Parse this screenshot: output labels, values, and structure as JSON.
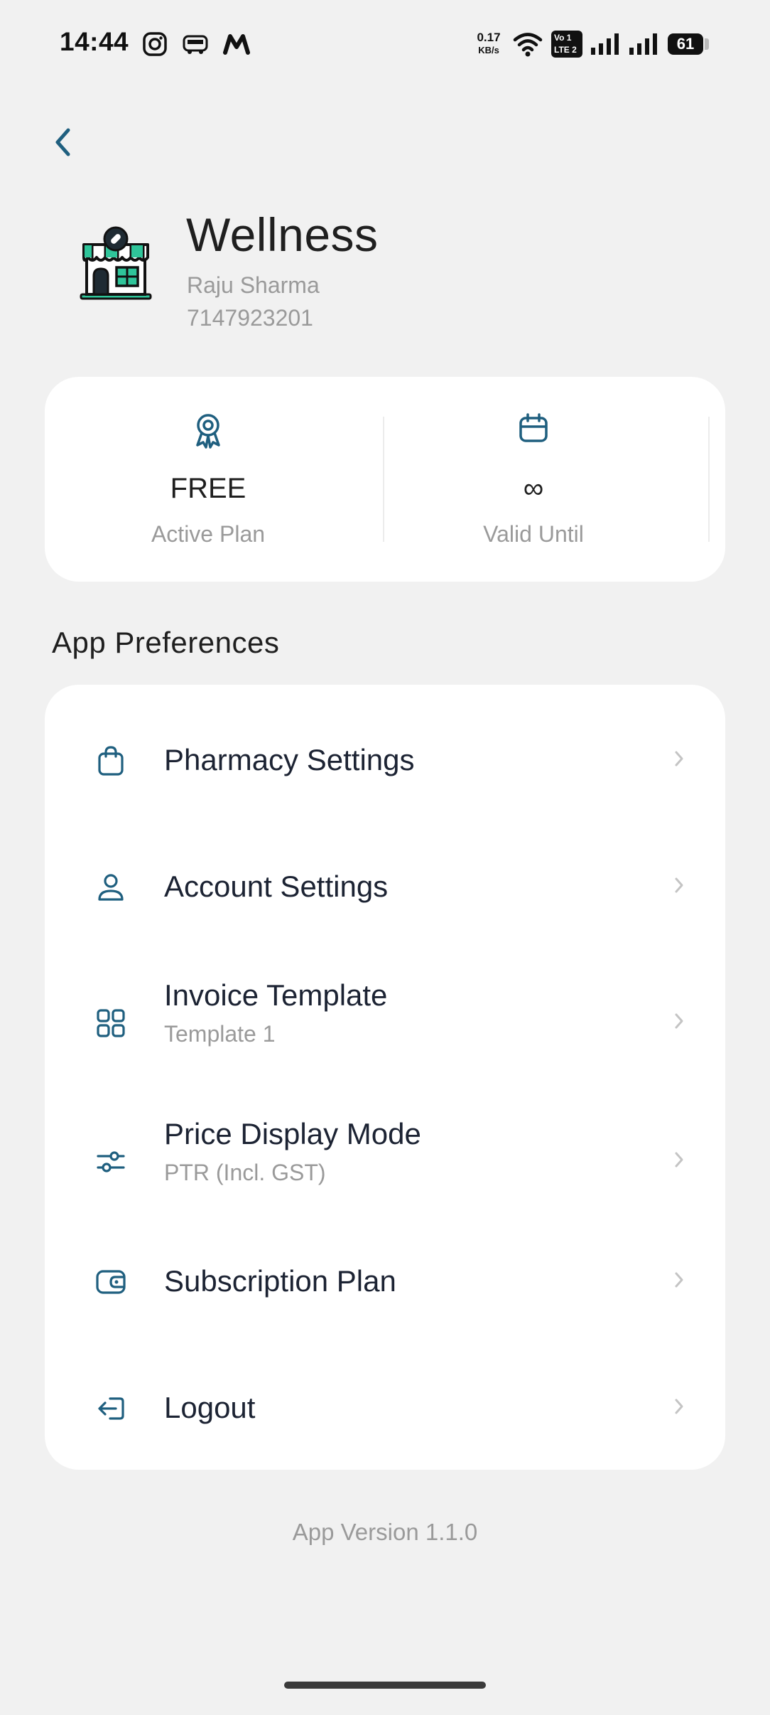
{
  "status_bar": {
    "time": "14:44",
    "net_speed_value": "0.17",
    "net_speed_unit": "KB/s",
    "volte_top": "Vo 1",
    "volte_bottom": "LTE 2",
    "battery": "61",
    "notification_icons": [
      "instagram-icon",
      "redbus-icon",
      "myntra-icon"
    ]
  },
  "header": {
    "back_icon": "chevron-left-icon",
    "shop_name": "Wellness",
    "owner_name": "Raju Sharma",
    "phone": "7147923201"
  },
  "plan": {
    "active_plan_value": "FREE",
    "active_plan_label": "Active Plan",
    "valid_until_value": "∞",
    "valid_until_label": "Valid Until"
  },
  "preferences": {
    "title": "App Preferences",
    "items": [
      {
        "icon": "shopping-bag-icon",
        "title": "Pharmacy Settings",
        "subtitle": ""
      },
      {
        "icon": "user-icon",
        "title": "Account Settings",
        "subtitle": ""
      },
      {
        "icon": "grid-icon",
        "title": "Invoice Template",
        "subtitle": "Template 1"
      },
      {
        "icon": "sliders-icon",
        "title": "Price Display Mode",
        "subtitle": "PTR (Incl. GST)"
      },
      {
        "icon": "wallet-icon",
        "title": "Subscription Plan",
        "subtitle": ""
      },
      {
        "icon": "logout-icon",
        "title": "Logout",
        "subtitle": ""
      }
    ]
  },
  "footer": {
    "app_version": "App Version 1.1.0"
  },
  "colors": {
    "accent": "#1f5f7f",
    "background": "#f1f1f1",
    "card": "#ffffff",
    "muted_text": "#9a9a9a"
  }
}
